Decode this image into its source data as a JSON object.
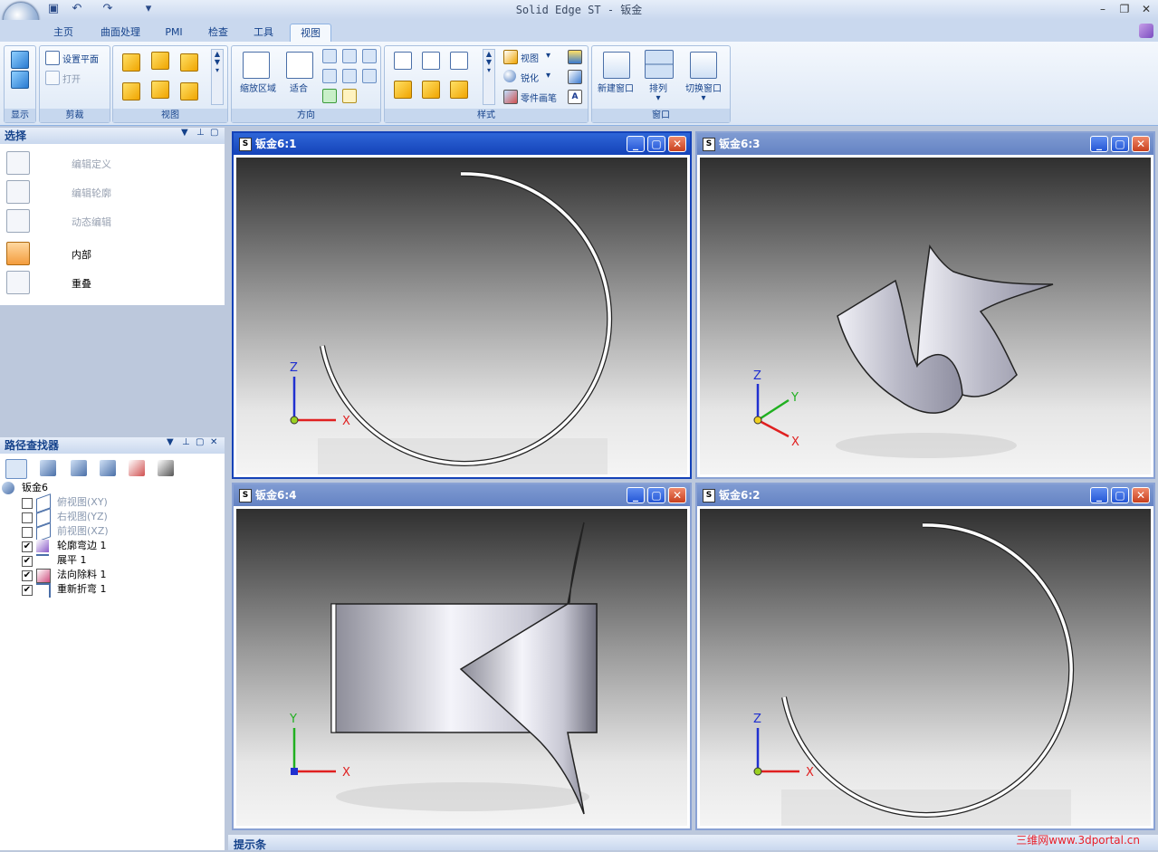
{
  "titlebar": {
    "title": "Solid Edge ST - 钣金"
  },
  "tabs": [
    "主页",
    "曲面处理",
    "PMI",
    "检查",
    "工具",
    "视图"
  ],
  "active_tab": "视图",
  "ribbon": {
    "groups": {
      "display": "显示",
      "clip": "剪裁",
      "views": "视图",
      "orient": "方向",
      "style": "样式",
      "window": "窗口"
    },
    "clip": {
      "set_plane": "设置平面",
      "open": "打开"
    },
    "orient": {
      "zoom_area": "缩放区域",
      "fit": "适合"
    },
    "style": {
      "views": "视图",
      "sharpen": "锐化",
      "part_painter": "零件画笔"
    },
    "window": {
      "new_window": "新建窗口",
      "arrange": "排列",
      "switch_window": "切换窗口"
    }
  },
  "select_panel": {
    "title": "选择",
    "items": [
      {
        "label": "编辑定义",
        "enabled": false
      },
      {
        "label": "编辑轮廓",
        "enabled": false
      },
      {
        "label": "动态编辑",
        "enabled": false
      },
      {
        "label": "内部",
        "enabled": true,
        "active": true
      },
      {
        "label": "重叠",
        "enabled": true,
        "active": false
      }
    ]
  },
  "path_finder": {
    "title": "路径查找器",
    "root": "钣金6",
    "items": [
      {
        "label": "俯视图(XY)",
        "checked": false,
        "dim": true
      },
      {
        "label": "右视图(YZ)",
        "checked": false,
        "dim": true
      },
      {
        "label": "前视图(XZ)",
        "checked": false,
        "dim": true
      },
      {
        "label": "轮廓弯边 1",
        "checked": true,
        "dim": false
      },
      {
        "label": "展平 1",
        "checked": true,
        "dim": false
      },
      {
        "label": "法向除料 1",
        "checked": true,
        "dim": false
      },
      {
        "label": "重新折弯 1",
        "checked": true,
        "dim": false
      }
    ]
  },
  "viewports": [
    {
      "title": "钣金6:1",
      "active": true,
      "axes": [
        "Z",
        "X"
      ]
    },
    {
      "title": "钣金6:3",
      "active": false,
      "axes": [
        "Z",
        "Y",
        "X"
      ]
    },
    {
      "title": "钣金6:4",
      "active": false,
      "axes": [
        "Y",
        "X"
      ]
    },
    {
      "title": "钣金6:2",
      "active": false,
      "axes": [
        "Z",
        "X"
      ]
    }
  ],
  "hint_bar": {
    "label": "提示条"
  },
  "watermark": "三维网www.3dportal.cn",
  "colors": {
    "active_title": "#1442b8",
    "inactive_title": "#6482c3",
    "axis_x": "#e02020",
    "axis_y": "#20b020",
    "axis_z": "#2030d0"
  }
}
